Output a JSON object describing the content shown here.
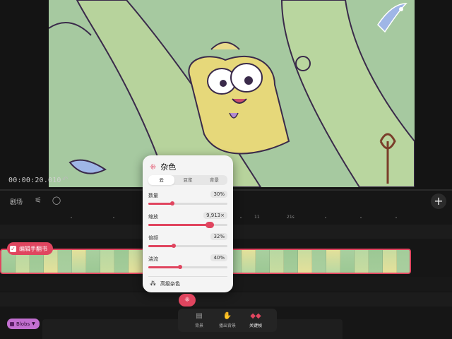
{
  "preview": {
    "timecode": "00:00:20.010"
  },
  "toolbar": {
    "script_label": "剧场",
    "icons": [
      "sliders-icon",
      "comment-icon",
      "add-icon"
    ]
  },
  "ruler": {
    "marks": [
      "11",
      "21s"
    ]
  },
  "track": {
    "handbook_label": "编辑手翻书",
    "blobs_label": "Blobs",
    "blobs_color": "#c26fd0"
  },
  "accent_color": "#e0455f",
  "panel": {
    "title": "杂色",
    "tabs": [
      {
        "label": "云",
        "selected": true
      },
      {
        "label": "豆浆",
        "selected": false
      },
      {
        "label": "背景",
        "selected": false
      }
    ],
    "sliders": [
      {
        "name": "数量",
        "value": "30%",
        "level": 0.3
      },
      {
        "name": "缩放",
        "value": "9,913×",
        "level": 0.78
      },
      {
        "name": "倍频",
        "value": "32%",
        "level": 0.32
      },
      {
        "name": "湍流",
        "value": "40%",
        "level": 0.4
      }
    ],
    "advanced_label": "高级杂色"
  },
  "bottom_bar": {
    "items": [
      {
        "label": "背景",
        "icon": "layers-icon",
        "active": false
      },
      {
        "label": "播出背景",
        "icon": "hand-icon",
        "active": false
      },
      {
        "label": "关键帧",
        "icon": "keyframe-icon",
        "active": true
      }
    ]
  }
}
